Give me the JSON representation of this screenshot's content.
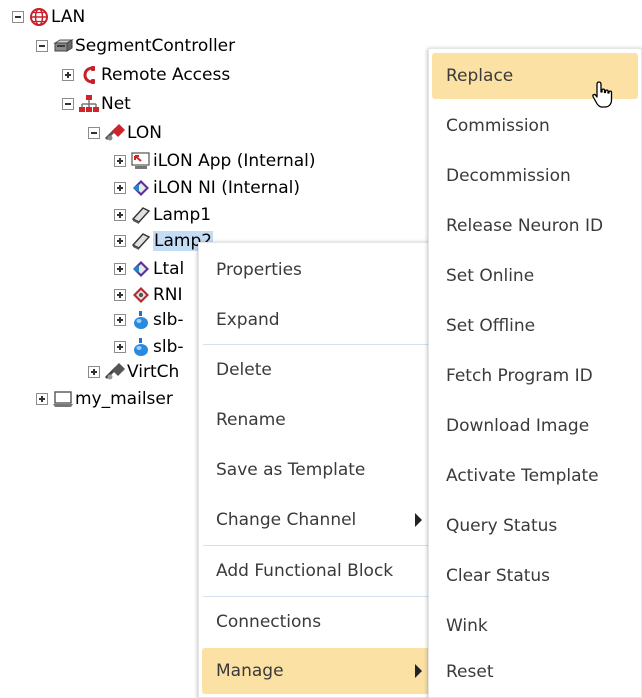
{
  "tree": {
    "items": [
      {
        "label": "LAN",
        "icon": "globe-icon"
      },
      {
        "label": "SegmentController",
        "icon": "controller-icon"
      },
      {
        "label": "Remote Access",
        "icon": "phone-icon"
      },
      {
        "label": "Net",
        "icon": "network-icon"
      },
      {
        "label": "LON",
        "icon": "lon-channel-icon"
      },
      {
        "label": "iLON App (Internal)",
        "icon": "app-device-icon"
      },
      {
        "label": "iLON NI (Internal)",
        "icon": "ni-device-icon"
      },
      {
        "label": "Lamp1",
        "icon": "lamp-icon"
      },
      {
        "label": "Lamp2",
        "icon": "lamp-icon"
      },
      {
        "label": "Ltal",
        "icon": "ni-device-icon"
      },
      {
        "label": "RNI",
        "icon": "rni-icon"
      },
      {
        "label": "slb-",
        "icon": "slb-device-icon"
      },
      {
        "label": "slb-",
        "icon": "slb-device-icon"
      },
      {
        "label": "VirtCh",
        "icon": "virtual-channel-icon"
      },
      {
        "label": "my_mailser",
        "icon": "laptop-icon"
      }
    ]
  },
  "context_menu": {
    "items": [
      {
        "label": "Properties"
      },
      {
        "label": "Expand"
      },
      {
        "label": "Delete"
      },
      {
        "label": "Rename"
      },
      {
        "label": "Save as Template"
      },
      {
        "label": "Change Channel"
      },
      {
        "label": "Add Functional Block"
      },
      {
        "label": "Connections"
      },
      {
        "label": "Manage"
      }
    ],
    "highlighted": "Manage"
  },
  "submenu": {
    "items": [
      {
        "label": "Replace"
      },
      {
        "label": "Commission"
      },
      {
        "label": "Decommission"
      },
      {
        "label": "Release Neuron ID"
      },
      {
        "label": "Set Online"
      },
      {
        "label": "Set Offline"
      },
      {
        "label": "Fetch Program ID"
      },
      {
        "label": "Download Image"
      },
      {
        "label": "Activate Template"
      },
      {
        "label": "Query Status"
      },
      {
        "label": "Clear Status"
      },
      {
        "label": "Wink"
      },
      {
        "label": "Reset"
      }
    ],
    "highlighted": "Replace"
  },
  "colors": {
    "highlight": "#fbe1a4",
    "selection": "#c5dcf5",
    "separator": "#d4e1f1"
  }
}
